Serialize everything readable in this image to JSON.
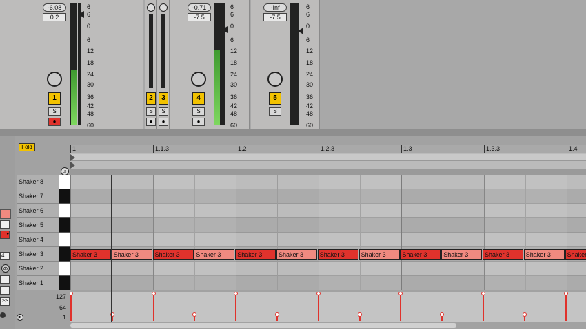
{
  "mixer": {
    "strips": [
      {
        "volume": "-6.08",
        "pan": "0.2",
        "number": "1",
        "solo": "S"
      },
      {
        "number": "2"
      },
      {
        "number": "3"
      },
      {
        "volume": "-0.71",
        "pan": "-7.5",
        "number": "4",
        "solo": "S"
      },
      {
        "volume": "-Inf",
        "pan": "-7.5",
        "number": "5",
        "solo": "S"
      }
    ],
    "meter_scale": [
      "6",
      "6",
      "0",
      "6",
      "12",
      "18",
      "24",
      "30",
      "36",
      "42",
      "48",
      "60"
    ],
    "meter_levels": [
      0.45,
      0.0,
      0.0,
      0.62,
      0.0
    ]
  },
  "editor": {
    "fold_label": "Fold",
    "ruler": [
      "1",
      "1.1.3",
      "1.2",
      "1.2.3",
      "1.3",
      "1.3.3",
      "1.4"
    ],
    "lanes": [
      "Shaker 8",
      "Shaker 7",
      "Shaker 6",
      "Shaker 5",
      "Shaker 4",
      "Shaker 3",
      "Shaker 2",
      "Shaker 1"
    ],
    "notes": [
      "Shaker 3",
      "Shaker 3",
      "Shaker 3",
      "Shaker 3",
      "Shaker 3",
      "Shaker 3",
      "Shaker 3",
      "Shaker 3",
      "Shaker 3",
      "Shaker 3",
      "Shaker 3",
      "Shaker 3",
      "Shaker 3"
    ],
    "velocity_scale": [
      "127",
      "64",
      "1"
    ],
    "velocities": [
      127,
      30,
      127,
      30,
      127,
      30,
      127,
      30,
      127,
      30,
      127,
      30,
      127
    ]
  },
  "side_value": "4",
  "colors": {
    "note_strong": "#e0322c",
    "note_soft": "#f08a80",
    "accent": "#f2c200",
    "velocity": "#e0322c"
  }
}
